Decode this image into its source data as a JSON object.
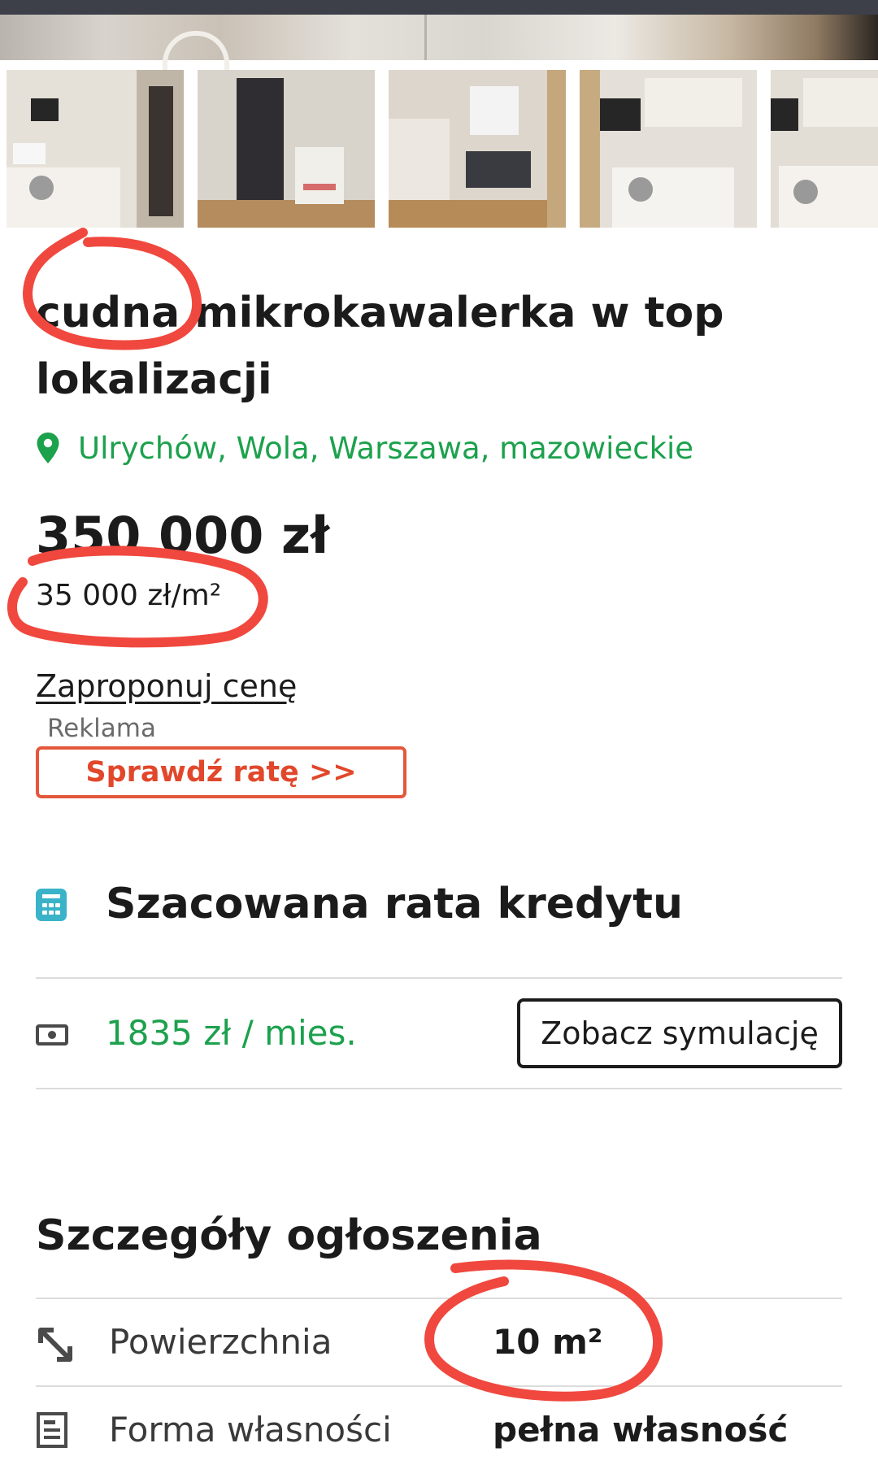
{
  "listing": {
    "title": "cudna mikrokawalerka w top lokalizacji",
    "location": "Ulrychów, Wola, Warszawa, mazowieckie",
    "price": "350 000 zł",
    "price_per_m2": "35 000 zł/m²",
    "offer_link": "Zaproponuj cenę",
    "ad_label": "Reklama",
    "rate_button": "Sprawdź ratę >>"
  },
  "loan": {
    "title": "Szacowana rata kredytu",
    "monthly": "1835 zł / mies.",
    "simulation_button": "Zobacz symulację"
  },
  "details": {
    "title": "Szczegóły ogłoszenia",
    "rows": [
      {
        "label": "Powierzchnia",
        "value": "10 m²",
        "icon": "resize-arrow-icon"
      },
      {
        "label": "Forma własności",
        "value": "pełna własność",
        "icon": "document-icon"
      }
    ]
  },
  "colors": {
    "location_green": "#1ca14d",
    "ad_button_red": "#e1472b",
    "calculator_teal": "#3ab3c9",
    "annotation_red": "#f0483e"
  }
}
